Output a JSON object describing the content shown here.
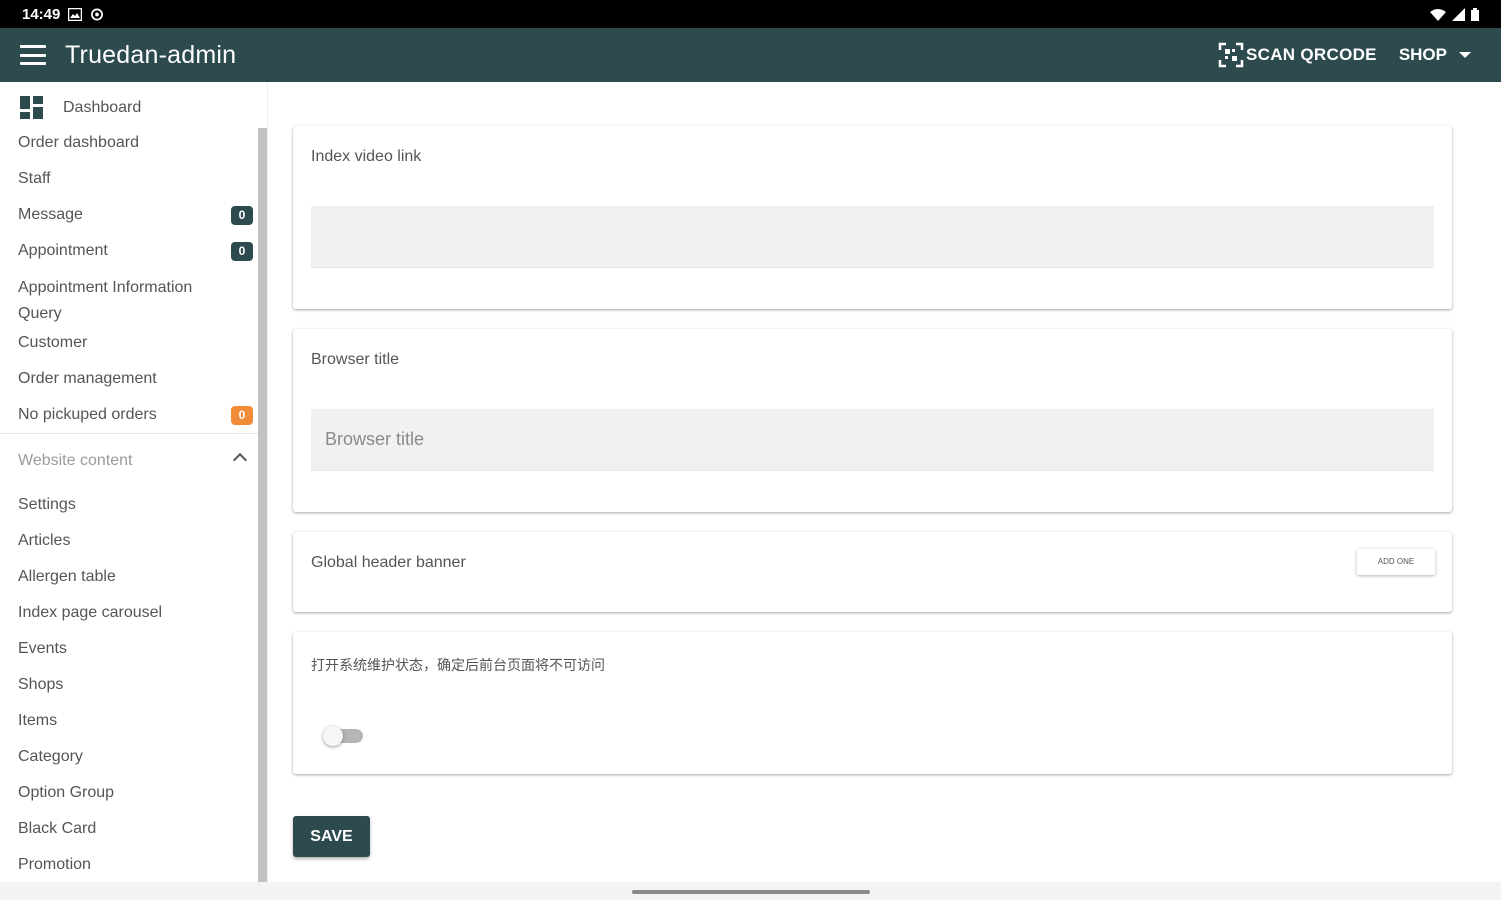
{
  "status_bar": {
    "time": "14:49"
  },
  "app_bar": {
    "title": "Truedan-admin",
    "scan_label": "SCAN QRCODE",
    "shop_label": "SHOP"
  },
  "sidebar": {
    "items": [
      {
        "label": "Dashboard"
      },
      {
        "label": "Order dashboard"
      },
      {
        "label": "Staff"
      },
      {
        "label": "Message",
        "badge": "0"
      },
      {
        "label": "Appointment",
        "badge": "0"
      },
      {
        "label": "Appointment Information Query"
      },
      {
        "label": "Customer"
      },
      {
        "label": "Order management"
      },
      {
        "label": "No pickuped orders",
        "badge": "0"
      }
    ],
    "section": {
      "label": "Website content"
    },
    "section_items": [
      {
        "label": "Settings"
      },
      {
        "label": "Articles"
      },
      {
        "label": "Allergen table"
      },
      {
        "label": "Index page carousel"
      },
      {
        "label": "Events"
      },
      {
        "label": "Shops"
      },
      {
        "label": "Items"
      },
      {
        "label": "Category"
      },
      {
        "label": "Option Group"
      },
      {
        "label": "Black Card"
      },
      {
        "label": "Promotion"
      }
    ]
  },
  "form": {
    "video_link": {
      "label": "Index video link",
      "value": "",
      "placeholder": ""
    },
    "browser_title": {
      "label": "Browser title",
      "value": "",
      "placeholder": "Browser title"
    },
    "header_banner": {
      "label": "Global header banner",
      "add_label": "ADD ONE"
    },
    "maintenance": {
      "label": "打开系统维护状态，确定后前台页面将不可访问",
      "enabled": false
    },
    "save_label": "SAVE"
  },
  "colors": {
    "primary": "#2d4a4f",
    "badge_orange": "#f28c38"
  }
}
